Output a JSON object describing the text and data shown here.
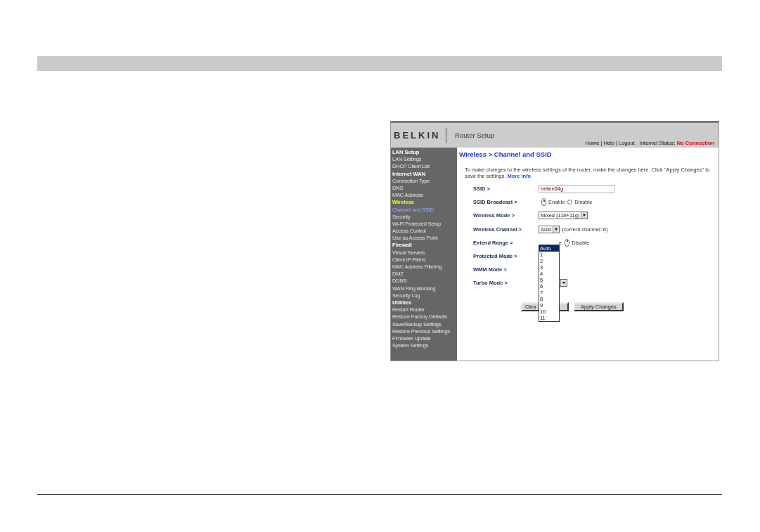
{
  "router_page": {
    "logo": "BELKIN",
    "logo_mark": ".",
    "app_title": "Router Setup",
    "top_links": [
      "Home",
      "Help",
      "Logout"
    ],
    "link_separators": [
      "|",
      "|"
    ],
    "status_label": "Internet Status:",
    "status_value": "No Connection",
    "sidebar": [
      {
        "label": "LAN Setup",
        "kind": "heading",
        "selected": false
      },
      {
        "label": "LAN Settings",
        "kind": "item",
        "selected": false
      },
      {
        "label": "DHCP Client List",
        "kind": "item",
        "selected": false
      },
      {
        "label": "Internet WAN",
        "kind": "heading",
        "selected": false
      },
      {
        "label": "Connection Type",
        "kind": "item",
        "selected": false
      },
      {
        "label": "DNS",
        "kind": "item",
        "selected": false
      },
      {
        "label": "MAC Address",
        "kind": "item",
        "selected": false
      },
      {
        "label": "Wireless",
        "kind": "heading",
        "selected": true
      },
      {
        "label": "Channel and SSID",
        "kind": "item",
        "selected": true
      },
      {
        "label": "Security",
        "kind": "item",
        "selected": false
      },
      {
        "label": "Wi-Fi Protected Setup",
        "kind": "item",
        "selected": false
      },
      {
        "label": "Access Control",
        "kind": "item",
        "selected": false
      },
      {
        "label": "Use as Access Point",
        "kind": "item",
        "selected": false
      },
      {
        "label": "Firewall",
        "kind": "heading",
        "selected": false
      },
      {
        "label": "Virtual Servers",
        "kind": "item",
        "selected": false
      },
      {
        "label": "Client IP Filters",
        "kind": "item",
        "selected": false
      },
      {
        "label": "MAC Address Filtering",
        "kind": "item",
        "selected": false
      },
      {
        "label": "DMZ",
        "kind": "item",
        "selected": false
      },
      {
        "label": "DDNS",
        "kind": "item",
        "selected": false
      },
      {
        "label": "WAN Ping Blocking",
        "kind": "item",
        "selected": false
      },
      {
        "label": "Security Log",
        "kind": "item",
        "selected": false
      },
      {
        "label": "Utilities",
        "kind": "heading",
        "selected": false
      },
      {
        "label": "Restart Router",
        "kind": "item",
        "selected": false
      },
      {
        "label": "Restore Factory Defaults",
        "kind": "item",
        "selected": false
      },
      {
        "label": "Save/Backup Settings",
        "kind": "item",
        "selected": false
      },
      {
        "label": "Restore Previous Settings",
        "kind": "item",
        "selected": false
      },
      {
        "label": "Firmware Update",
        "kind": "item",
        "selected": false
      },
      {
        "label": "System Settings",
        "kind": "item",
        "selected": false
      }
    ],
    "heading": "Wireless > Channel and SSID",
    "intro": "To make changes to the wireless settings of the router, make the changes here. Click \"Apply Changes\" to save the settings.",
    "more_info_link": "More Info",
    "rows": [
      {
        "label": "SSID >",
        "kind": "text",
        "value": "belkin54g"
      },
      {
        "label": "SSID Broadcast >",
        "kind": "radio",
        "options": [
          {
            "label": "Enable",
            "selected": true
          },
          {
            "label": "Disable",
            "selected": false
          }
        ]
      },
      {
        "label": "Wireless Mode >",
        "kind": "select",
        "value": "Mixed (11b+11g)"
      },
      {
        "label": "Wireless Channel >",
        "kind": "select",
        "value": "Auto",
        "note": "(current channel: 6)"
      },
      {
        "label": "Extend Range >",
        "kind": "radio",
        "partial_text": "e",
        "options": [
          {
            "label": "Disable",
            "selected": true
          }
        ]
      },
      {
        "label": "Protected Mode >",
        "kind": "hidden"
      },
      {
        "label": "WMM Mode >",
        "kind": "hidden"
      },
      {
        "label": "Turbo Mode >",
        "kind": "select"
      }
    ],
    "buttons": [
      "Clea",
      "Apply Changes"
    ],
    "channel_dropdown": [
      {
        "label": "Auto",
        "selected": true
      },
      {
        "label": "1",
        "selected": false
      },
      {
        "label": "2",
        "selected": false
      },
      {
        "label": "3",
        "selected": false
      },
      {
        "label": "4",
        "selected": false
      },
      {
        "label": "5",
        "selected": false
      },
      {
        "label": "6",
        "selected": false
      },
      {
        "label": "7",
        "selected": false
      },
      {
        "label": "8",
        "selected": false
      },
      {
        "label": "9",
        "selected": false
      },
      {
        "label": "10",
        "selected": false
      },
      {
        "label": "11",
        "selected": false
      }
    ]
  }
}
